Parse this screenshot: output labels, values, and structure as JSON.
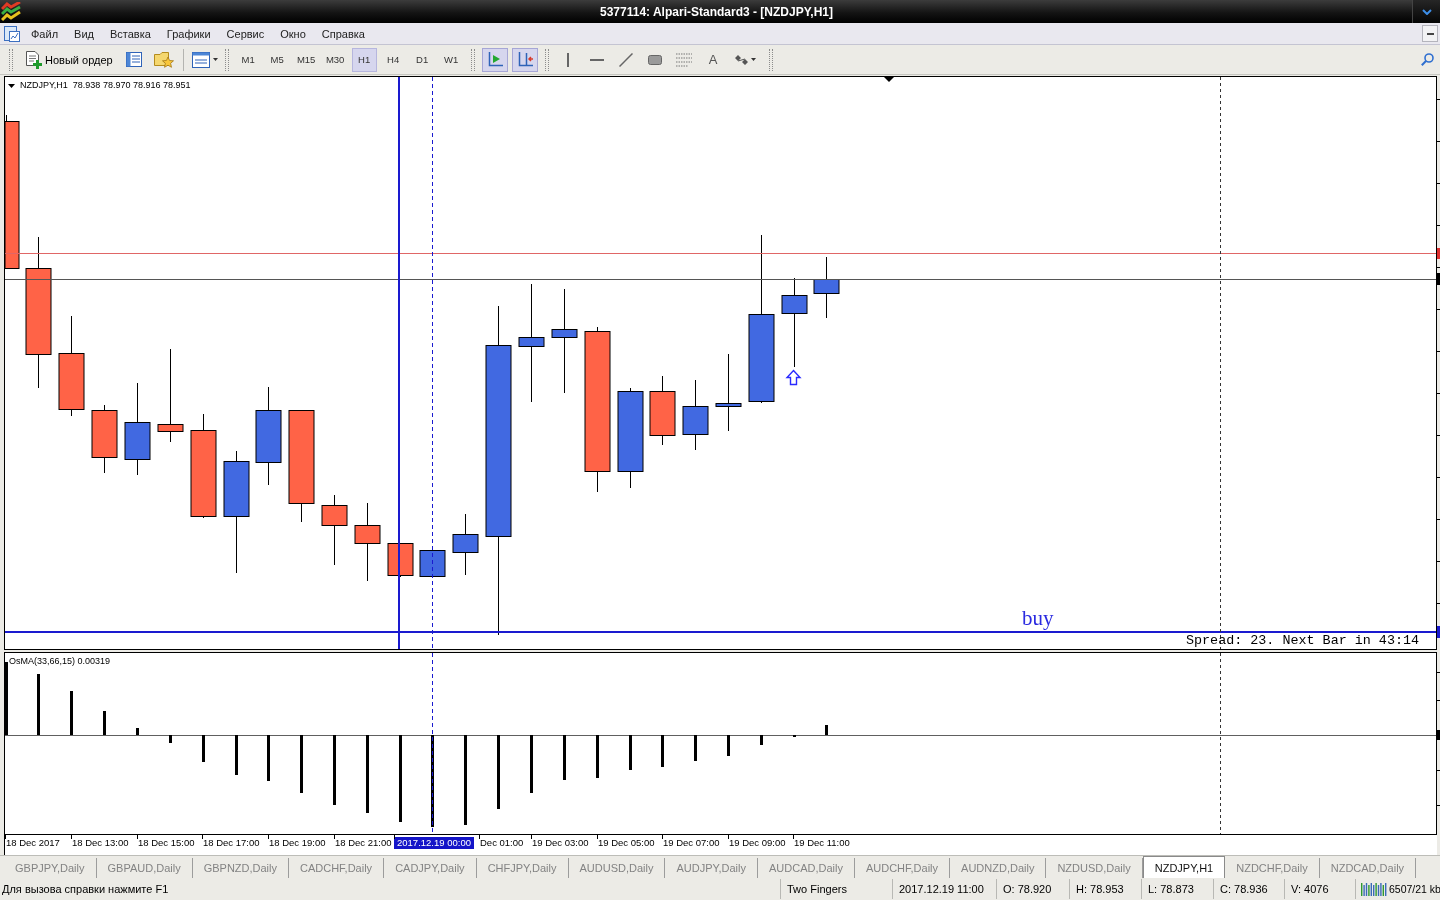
{
  "window": {
    "title": "5377114: Alpari-Standard3 - [NZDJPY,H1]"
  },
  "menu": [
    "Файл",
    "Вид",
    "Вставка",
    "Графики",
    "Сервис",
    "Окно",
    "Справка"
  ],
  "toolbar": {
    "new_order": "Новый ордер",
    "timeframes": [
      {
        "label": "M1",
        "selected": false
      },
      {
        "label": "M5",
        "selected": false
      },
      {
        "label": "M15",
        "selected": false
      },
      {
        "label": "M30",
        "selected": false
      },
      {
        "label": "H1",
        "selected": true
      },
      {
        "label": "H4",
        "selected": false
      },
      {
        "label": "D1",
        "selected": false
      },
      {
        "label": "W1",
        "selected": false
      }
    ],
    "chart_modes": [
      {
        "kind": "auto-scroll",
        "selected": true
      },
      {
        "kind": "chart-shift",
        "selected": true
      }
    ],
    "tools": [
      {
        "kind": "vertical-line"
      },
      {
        "kind": "horizontal-line"
      },
      {
        "kind": "trend-line"
      },
      {
        "kind": "rectangle"
      },
      {
        "kind": "fibonacci"
      },
      {
        "kind": "text",
        "label": "A"
      },
      {
        "kind": "arrows"
      }
    ]
  },
  "chart": {
    "header": "NZDJPY,H1  78.938 78.970 78.916 78.951",
    "label": "buy",
    "info": "Spread: 23. Next Bar in 43:14"
  },
  "indicator": {
    "header": "OsMA(33,66,15) 0.00319"
  },
  "time_axis": [
    {
      "label": "18 Dec 2017",
      "highlighted": false
    },
    {
      "label": "18 Dec 13:00",
      "highlighted": false
    },
    {
      "label": "18 Dec 15:00",
      "highlighted": false
    },
    {
      "label": "18 Dec 17:00",
      "highlighted": false
    },
    {
      "label": "18 Dec 19:00",
      "highlighted": false
    },
    {
      "label": "18 Dec 21:00",
      "highlighted": false
    },
    {
      "label": "2017.12.19 00:00",
      "highlighted": true
    },
    {
      "label": "Dec 01:00",
      "highlighted": false
    },
    {
      "label": "19 Dec 03:00",
      "highlighted": false
    },
    {
      "label": "19 Dec 05:00",
      "highlighted": false
    },
    {
      "label": "19 Dec 07:00",
      "highlighted": false
    },
    {
      "label": "19 Dec 09:00",
      "highlighted": false
    },
    {
      "label": "19 Dec 11:00",
      "highlighted": false
    }
  ],
  "symbol_tabs": [
    {
      "label": "GBPJPY,Daily",
      "selected": false
    },
    {
      "label": "GBPAUD,Daily",
      "selected": false
    },
    {
      "label": "GBPNZD,Daily",
      "selected": false
    },
    {
      "label": "CADCHF,Daily",
      "selected": false
    },
    {
      "label": "CADJPY,Daily",
      "selected": false
    },
    {
      "label": "CHFJPY,Daily",
      "selected": false
    },
    {
      "label": "AUDUSD,Daily",
      "selected": false
    },
    {
      "label": "AUDJPY,Daily",
      "selected": false
    },
    {
      "label": "AUDCAD,Daily",
      "selected": false
    },
    {
      "label": "AUDCHF,Daily",
      "selected": false
    },
    {
      "label": "AUDNZD,Daily",
      "selected": false
    },
    {
      "label": "NZDUSD,Daily",
      "selected": false
    },
    {
      "label": "NZDJPY,H1",
      "selected": true
    },
    {
      "label": "NZDCHF,Daily",
      "selected": false
    },
    {
      "label": "NZDCAD,Daily",
      "selected": false
    }
  ],
  "status_bar": {
    "help": "Для вызова справки нажмите F1",
    "profile": "Two Fingers",
    "time": "2017.12.19 11:00",
    "open": "O: 78.920",
    "high": "H: 78.953",
    "low": "L: 78.873",
    "close": "C: 78.936",
    "volume": "V: 4076",
    "traffic": "6507/21 kb"
  }
}
